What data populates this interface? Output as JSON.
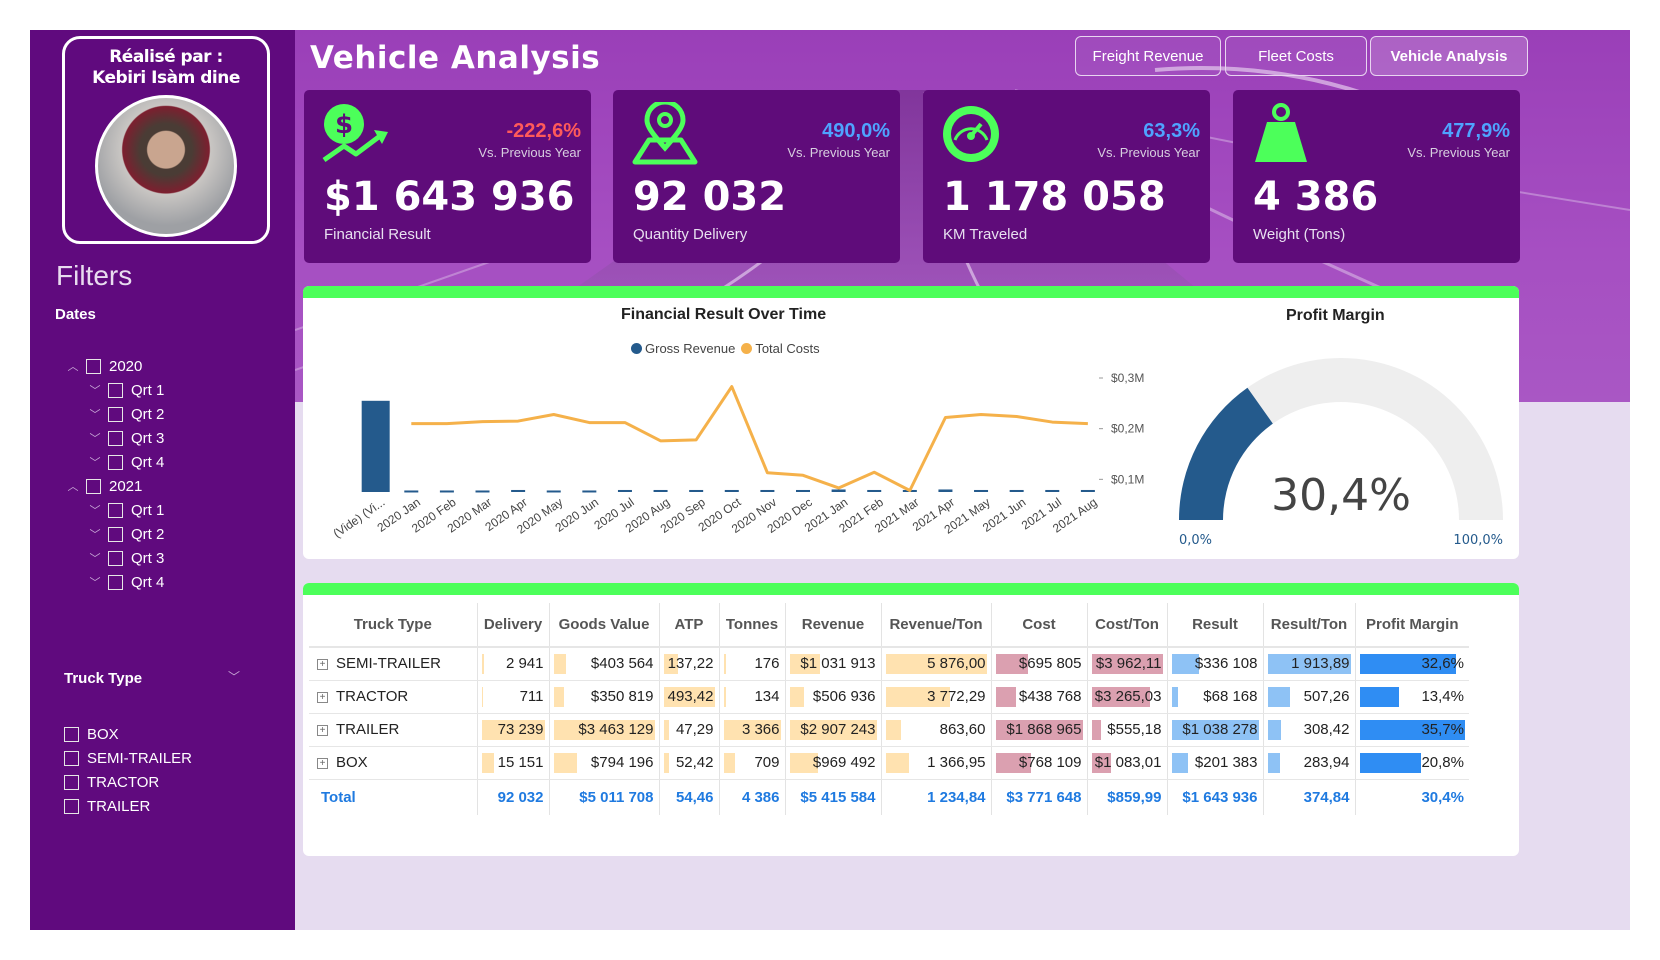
{
  "author": {
    "line1": "Réalisé par :",
    "line2": "Kebiri Isàm dine"
  },
  "filters": {
    "title": "Filters",
    "dates_label": "Dates",
    "years": [
      {
        "label": "2020",
        "quarters": [
          "Qrt 1",
          "Qrt 2",
          "Qrt 3",
          "Qrt 4"
        ]
      },
      {
        "label": "2021",
        "quarters": [
          "Qrt 1",
          "Qrt 2",
          "Qrt 3",
          "Qrt 4"
        ]
      }
    ],
    "truck_type_label": "Truck Type",
    "truck_types": [
      "BOX",
      "SEMI-TRAILER",
      "TRACTOR",
      "TRAILER"
    ]
  },
  "header": {
    "title": "Vehicle Analysis"
  },
  "nav": [
    {
      "label": "Freight Revenue",
      "active": false
    },
    {
      "label": "Fleet Costs",
      "active": false
    },
    {
      "label": "Vehicle Analysis",
      "active": true
    }
  ],
  "kpis": [
    {
      "icon": "dollar-growth-icon",
      "change": "-222,6%",
      "change_color": "#ff5a5a",
      "vs": "Vs. Previous Year",
      "value": "$1 643 936",
      "label": "Financial Result"
    },
    {
      "icon": "map-pin-icon",
      "change": "490,0%",
      "change_color": "#4fa3ff",
      "vs": "Vs. Previous Year",
      "value": "92 032",
      "label": "Quantity Delivery"
    },
    {
      "icon": "speedometer-icon",
      "change": "63,3%",
      "change_color": "#4fa3ff",
      "vs": "Vs. Previous Year",
      "value": "1 178 058",
      "label": "KM Traveled"
    },
    {
      "icon": "weight-icon",
      "change": "477,9%",
      "change_color": "#4fa3ff",
      "vs": "Vs. Previous Year",
      "value": "4 386",
      "label": "Weight (Tons)"
    }
  ],
  "colors": {
    "accent_green": "#4cff5a",
    "revenue_blue": "#245a8c",
    "cost_orange": "#f5b14a",
    "sidebar_purple": "#600a7e"
  },
  "chart_data": [
    {
      "type": "bar",
      "title": "Financial Result Over Time",
      "categories": [
        "(Vide) (Vi...",
        "2020 Jan",
        "2020 Feb",
        "2020 Mar",
        "2020 Apr",
        "2020 May",
        "2020 Jun",
        "2020 Jul",
        "2020 Aug",
        "2020 Sep",
        "2020 Oct",
        "2020 Nov",
        "2020 Dec",
        "2021 Jan",
        "2021 Feb",
        "2021 Mar",
        "2021 Apr",
        "2021 May",
        "2021 Jun",
        "2021 Jul",
        "2021 Aug"
      ],
      "y_ticks": [
        "$0,3M",
        "$0,2M",
        "$0,1M"
      ],
      "ylim": [
        0.075,
        0.3
      ],
      "series": [
        {
          "name": "Gross Revenue",
          "kind": "bar",
          "color": "#245a8c",
          "values": [
            0.255,
            0.078,
            0.078,
            0.078,
            0.079,
            0.078,
            0.078,
            0.079,
            0.079,
            0.079,
            0.079,
            0.079,
            0.079,
            0.08,
            0.079,
            0.079,
            0.08,
            0.079,
            0.079,
            0.079,
            0.079
          ]
        },
        {
          "name": "Total Costs",
          "kind": "line",
          "color": "#f5b14a",
          "values": [
            null,
            0.21,
            0.21,
            0.214,
            0.215,
            0.228,
            0.212,
            0.212,
            0.176,
            0.178,
            0.283,
            0.113,
            0.108,
            0.083,
            0.114,
            0.078,
            0.222,
            0.228,
            0.224,
            0.213,
            0.21
          ]
        }
      ]
    },
    {
      "type": "gauge",
      "title": "Profit Margin",
      "value": 30.4,
      "value_label": "30,4%",
      "min_label": "0,0%",
      "max_label": "100,0%",
      "fill_color": "#245a8c",
      "track_color": "#eeeeee"
    },
    {
      "type": "table",
      "columns": [
        "Truck Type",
        "Delivery",
        "Goods Value",
        "ATP",
        "Tonnes",
        "Revenue",
        "Revenue/Ton",
        "Cost",
        "Cost/Ton",
        "Result",
        "Result/Ton",
        "Profit Margin"
      ],
      "rows": [
        {
          "name": "SEMI-TRAILER",
          "cells": [
            "2 941",
            "$403 564",
            "137,22",
            "176",
            "$1 031 913",
            "5 876,00",
            "$695 805",
            "$3 962,11",
            "$336 108",
            "1 913,89",
            "32,6%"
          ],
          "bars": [
            0.04,
            0.12,
            0.28,
            0.05,
            0.35,
            1.0,
            0.37,
            1.0,
            0.32,
            1.0,
            0.913
          ]
        },
        {
          "name": "TRACTOR",
          "cells": [
            "711",
            "$350 819",
            "493,42",
            "134",
            "$506 936",
            "3 772,29",
            "$438 768",
            "$3 265,03",
            "$68 168",
            "507,26",
            "13,4%"
          ],
          "bars": [
            0.01,
            0.1,
            1.0,
            0.04,
            0.17,
            0.64,
            0.23,
            0.82,
            0.07,
            0.27,
            0.375
          ]
        },
        {
          "name": "TRAILER",
          "cells": [
            "73 239",
            "$3 463 129",
            "47,29",
            "3 366",
            "$2 907 243",
            "863,60",
            "$1 868 965",
            "$555,18",
            "$1 038 278",
            "308,42",
            "35,7%"
          ],
          "bars": [
            1.0,
            1.0,
            0.1,
            1.0,
            1.0,
            0.15,
            1.0,
            0.14,
            1.0,
            0.16,
            1.0
          ]
        },
        {
          "name": "BOX",
          "cells": [
            "15 151",
            "$794 196",
            "52,42",
            "709",
            "$969 492",
            "1 366,95",
            "$768 109",
            "$1 083,01",
            "$201 383",
            "283,94",
            "20,8%"
          ],
          "bars": [
            0.2,
            0.23,
            0.11,
            0.21,
            0.33,
            0.23,
            0.41,
            0.27,
            0.19,
            0.15,
            0.583
          ]
        }
      ],
      "total": {
        "name": "Total",
        "cells": [
          "92 032",
          "$5 011 708",
          "54,46",
          "4 386",
          "$5 415 584",
          "1 234,84",
          "$3 771 648",
          "$859,99",
          "$1 643 936",
          "374,84",
          "30,4%"
        ]
      },
      "bar_colors": [
        "#ffe2b0",
        "#ffe2b0",
        "#ffe2b0",
        "#ffe2b0",
        "#ffe2b0",
        "#ffe2b0",
        "#dba0b0",
        "#dba0b0",
        "#8ec2f5",
        "#8ec2f5",
        "#2f8df3"
      ]
    }
  ]
}
